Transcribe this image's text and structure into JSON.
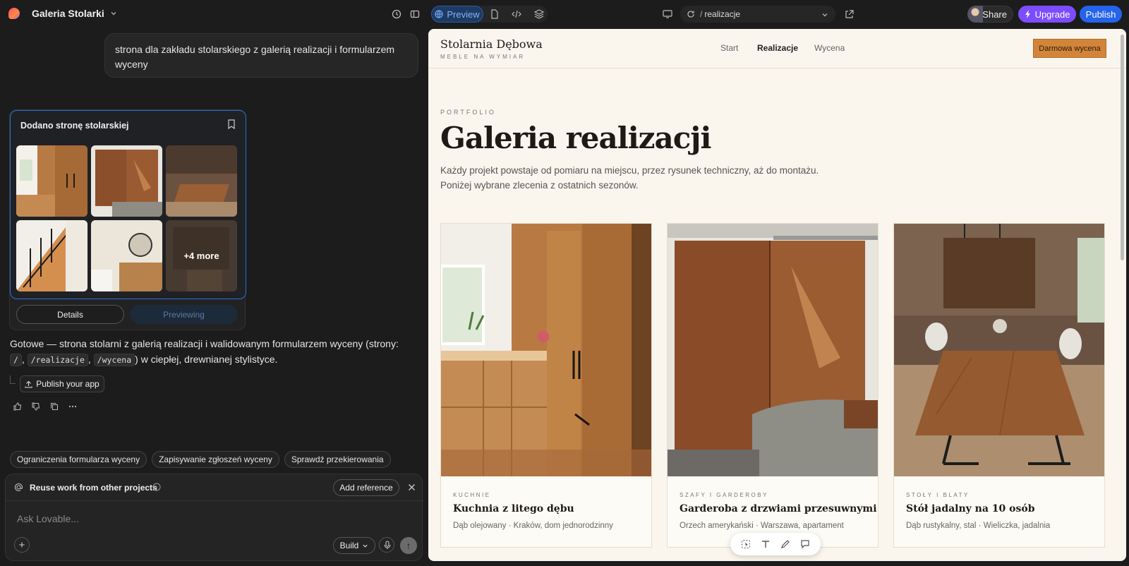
{
  "topbar": {
    "project_name": "Galeria Stolarki",
    "preview_label": "Preview",
    "url_path": "realizacje",
    "share_label": "Share",
    "upgrade_label": "Upgrade",
    "publish_label": "Publish"
  },
  "chat": {
    "prompt": "strona dla zakładu stolarskiego z galerią realizacji i formularzem wyceny",
    "card_title": "Dodano stronę stolarskiej",
    "more_label": "+4 more",
    "details_label": "Details",
    "previewing_label": "Previewing",
    "answer_pre": "Gotowe — strona stolarni z galerią realizacji i walidowanym formularzem wyceny (strony: ",
    "code_root": "/",
    "code_realizacje": "/realizacje",
    "code_wycena": "/wycena",
    "answer_post": ") w ciepłej, drewnianej stylistyce.",
    "publish_app_label": "Publish your app",
    "suggestions": [
      "Ograniczenia formularza wyceny",
      "Zapisywanie zgłoszeń wyceny",
      "Sprawdź przekierowania"
    ],
    "reuse_label": "Reuse work from other projects",
    "add_reference_label": "Add reference",
    "composer_placeholder": "Ask Lovable...",
    "build_label": "Build"
  },
  "site": {
    "brand": "Stolarnia Dębowa",
    "tagline": "MEBLE NA WYMIAR",
    "nav": [
      "Start",
      "Realizacje",
      "Wycena"
    ],
    "cta": "Darmowa wycena",
    "kicker": "PORTFOLIO",
    "title": "Galeria realizacji",
    "lead_1": "Każdy projekt powstaje od pomiaru na miejscu, przez rysunek techniczny, aż do montażu.",
    "lead_2": "Poniżej wybrane zlecenia z ostatnich sezonów.",
    "projects": [
      {
        "kicker": "KUCHNIE",
        "title": "Kuchnia z litego dębu",
        "desc": "Dąb olejowany · Kraków, dom jednorodzinny"
      },
      {
        "kicker": "SZAFY I GARDEROBY",
        "title": "Garderoba z drzwiami przesuwnymi",
        "desc": "Orzech amerykański · Warszawa, apartament"
      },
      {
        "kicker": "STOŁY I BLATY",
        "title": "Stół jadalny na 10 osób",
        "desc": "Dąb rustykalny, stal · Wieliczka, jadalnia"
      }
    ]
  },
  "colors": {
    "accent": "#2463eb",
    "upgrade": "#7c4dff",
    "cta": "#d2853a",
    "site_bg": "#faf6ee"
  }
}
